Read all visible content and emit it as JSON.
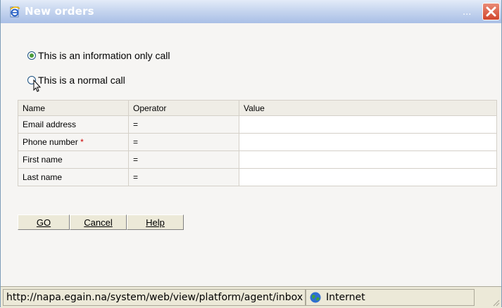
{
  "window": {
    "title": "New orders",
    "title_ellipsis": "..."
  },
  "call_type": {
    "options": [
      {
        "label": "This is an information only call",
        "checked": true
      },
      {
        "label": "This is a normal call",
        "checked": false
      }
    ]
  },
  "search_grid": {
    "headers": [
      "Name",
      "Operator",
      "Value"
    ],
    "rows": [
      {
        "name": "Email address",
        "required": false,
        "operator": "=",
        "value": ""
      },
      {
        "name": "Phone number",
        "required": true,
        "operator": "=",
        "value": ""
      },
      {
        "name": "First name",
        "required": false,
        "operator": "=",
        "value": ""
      },
      {
        "name": "Last name",
        "required": false,
        "operator": "=",
        "value": ""
      }
    ],
    "required_marker": "*"
  },
  "actions": {
    "go_label": "GO",
    "cancel_label": "Cancel",
    "help_label": "Help"
  },
  "statusbar": {
    "url": "http://napa.egain.na/system/web/view/platform/agent/inbox",
    "zone": "Internet"
  },
  "icons": {
    "app": "ie-page-icon",
    "close": "close-icon",
    "zone": "globe-icon",
    "cursor": "mouse-pointer-icon"
  },
  "colors": {
    "titlebar": "#a9bfe6",
    "close": "#d1452c",
    "required": "#cc0000"
  }
}
